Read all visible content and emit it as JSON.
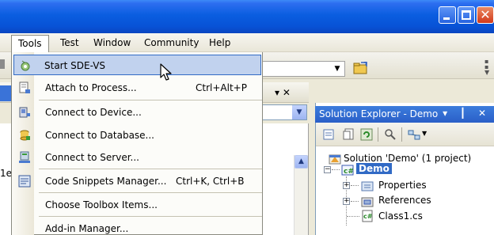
{
  "window": {
    "caption_buttons": [
      "minimize",
      "maximize",
      "close"
    ]
  },
  "menubar": {
    "items": [
      {
        "label": "Tools",
        "active": true
      },
      {
        "label": "Test"
      },
      {
        "label": "Window"
      },
      {
        "label": "Community"
      },
      {
        "label": "Help"
      }
    ]
  },
  "tools_menu": {
    "items": [
      {
        "label": "Start SDE-VS",
        "shortcut": "",
        "icon": "sde-vs-icon",
        "highlighted": true
      },
      {
        "label": "Attach to Process...",
        "shortcut": "Ctrl+Alt+P",
        "icon": "attach-process-icon"
      },
      {
        "label": "Connect to Device...",
        "shortcut": "",
        "icon": "device-icon"
      },
      {
        "label": "Connect to Database...",
        "shortcut": "",
        "icon": "database-icon"
      },
      {
        "label": "Connect to Server...",
        "shortcut": "",
        "icon": "server-icon"
      },
      {
        "label": "Code Snippets Manager...",
        "shortcut": "Ctrl+K, Ctrl+B",
        "icon": "snippets-icon"
      },
      {
        "label": "Choose Toolbox Items...",
        "shortcut": "",
        "icon": ""
      },
      {
        "label": "Add-in Manager...",
        "shortcut": "",
        "icon": ""
      }
    ]
  },
  "left_pane": {
    "close_glyph": "✕",
    "partial_text": "1e"
  },
  "solution_explorer": {
    "title": "Solution Explorer - Demo",
    "title_buttons": "▾ ┃ ✕",
    "tree": {
      "solution": "Solution 'Demo' (1 project)",
      "project": "Demo",
      "children": [
        "Properties",
        "References",
        "Class1.cs"
      ]
    }
  },
  "colors": {
    "titlebar": "#0a5ee0",
    "menu_highlight": "#c1d2ee",
    "menu_highlight_border": "#316ac5",
    "selection": "#316ac5"
  }
}
